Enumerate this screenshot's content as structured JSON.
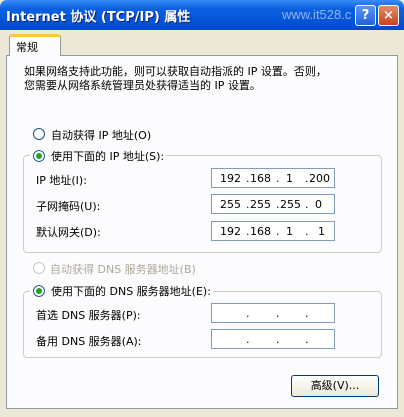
{
  "window": {
    "title": "Internet 协议 (TCP/IP) 属性",
    "watermark": "www.it528.c",
    "help_glyph": "?",
    "close_glyph": "×"
  },
  "tabs": [
    "常规"
  ],
  "description": {
    "line1": "如果网络支持此功能，则可以获取自动指派的 IP 设置。否则，",
    "line2": "您需要从网络系统管理员处获得适当的 IP 设置。"
  },
  "ip_section": {
    "auto_label": "自动获得 IP 地址(O)",
    "manual_label": "使用下面的 IP 地址(S):",
    "selected": "manual",
    "fields": [
      {
        "label": "IP 地址(I):",
        "octets": [
          "192",
          "168",
          "1",
          "200"
        ]
      },
      {
        "label": "子网掩码(U):",
        "octets": [
          "255",
          "255",
          "255",
          "0"
        ]
      },
      {
        "label": "默认网关(D):",
        "octets": [
          "192",
          "168",
          "1",
          "1"
        ]
      }
    ]
  },
  "dns_section": {
    "auto_label": "自动获得 DNS 服务器地址(B)",
    "auto_enabled": false,
    "manual_label": "使用下面的 DNS 服务器地址(E):",
    "selected": "manual",
    "fields": [
      {
        "label": "首选 DNS 服务器(P):",
        "octets": [
          "",
          "",
          "",
          ""
        ]
      },
      {
        "label": "备用 DNS 服务器(A):",
        "octets": [
          "",
          "",
          "",
          ""
        ]
      }
    ]
  },
  "advanced_button": "高级(V)...",
  "colors": {
    "title_bar": "#0554d8",
    "tab_highlight": "#ffc83c",
    "radio_dot": "#21a121",
    "close_button": "#c6451c"
  },
  "icons": {
    "help": "help-icon",
    "close": "close-icon"
  }
}
